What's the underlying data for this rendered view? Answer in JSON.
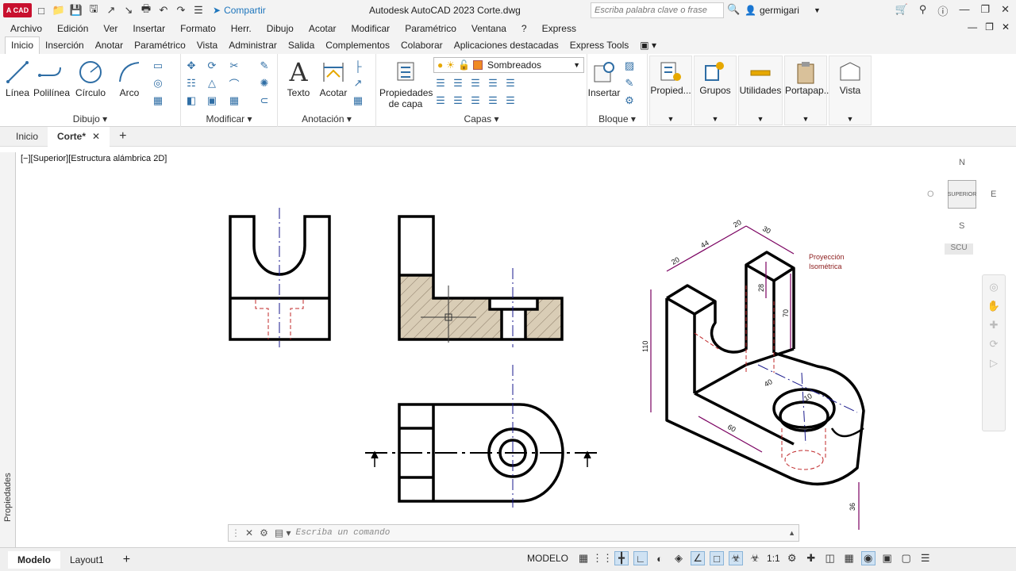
{
  "app": {
    "logo": "A CAD",
    "title": "Autodesk AutoCAD 2023    Corte.dwg",
    "share_label": "Compartir",
    "search_placeholder": "Escriba palabra clave o frase",
    "user": "germigari"
  },
  "menu": [
    "Archivo",
    "Edición",
    "Ver",
    "Insertar",
    "Formato",
    "Herr.",
    "Dibujo",
    "Acotar",
    "Modificar",
    "Paramétrico",
    "Ventana",
    "?",
    "Express"
  ],
  "ribbon_tabs": [
    "Inicio",
    "Inserción",
    "Anotar",
    "Paramétrico",
    "Vista",
    "Administrar",
    "Salida",
    "Complementos",
    "Colaborar",
    "Aplicaciones destacadas",
    "Express Tools"
  ],
  "ribbon": {
    "draw": {
      "title": "Dibujo",
      "linea": "Línea",
      "polilinea": "Polilínea",
      "circulo": "Círculo",
      "arco": "Arco"
    },
    "modify": {
      "title": "Modificar"
    },
    "annotation": {
      "title": "Anotación",
      "texto": "Texto",
      "acotar": "Acotar"
    },
    "layers": {
      "title": "Capas",
      "props_line1": "Propiedades",
      "props_line2": "de capa",
      "current_layer": "Sombreados",
      "layer_color": "#f08a24"
    },
    "block": {
      "title": "Bloque",
      "insertar": "Insertar"
    },
    "boxes": [
      "Propied...",
      "Grupos",
      "Utilidades",
      "Portapap...",
      "Vista"
    ]
  },
  "file_tabs": {
    "home": "Inicio",
    "current": "Corte*"
  },
  "side_panel_label": "Propiedades",
  "viewport_label": "[−][Superior][Estructura alámbrica 2D]",
  "viewcube": {
    "north": "N",
    "south": "S",
    "east": "E",
    "west": "O",
    "face": "SUPERIOR",
    "ucs": "SCU"
  },
  "drawing": {
    "iso_note_line1": "Proyección",
    "iso_note_line2": "Isométrica",
    "dims": {
      "d20a": "20",
      "d44": "44",
      "d20b": "20",
      "d30": "30",
      "d28": "28",
      "d70": "70",
      "d110": "110",
      "d60": "60",
      "d40": "40",
      "d36": "36",
      "d10": "10"
    },
    "hatch_color": "#d9cdb6",
    "line_color": "#000000",
    "center_color": "#1a1a8c",
    "hidden_color": "#c0282a"
  },
  "command_placeholder": "Escriba un comando",
  "status": {
    "model_tab": "Modelo",
    "layout_tab": "Layout1",
    "mode": "MODELO",
    "scale": "1:1"
  }
}
